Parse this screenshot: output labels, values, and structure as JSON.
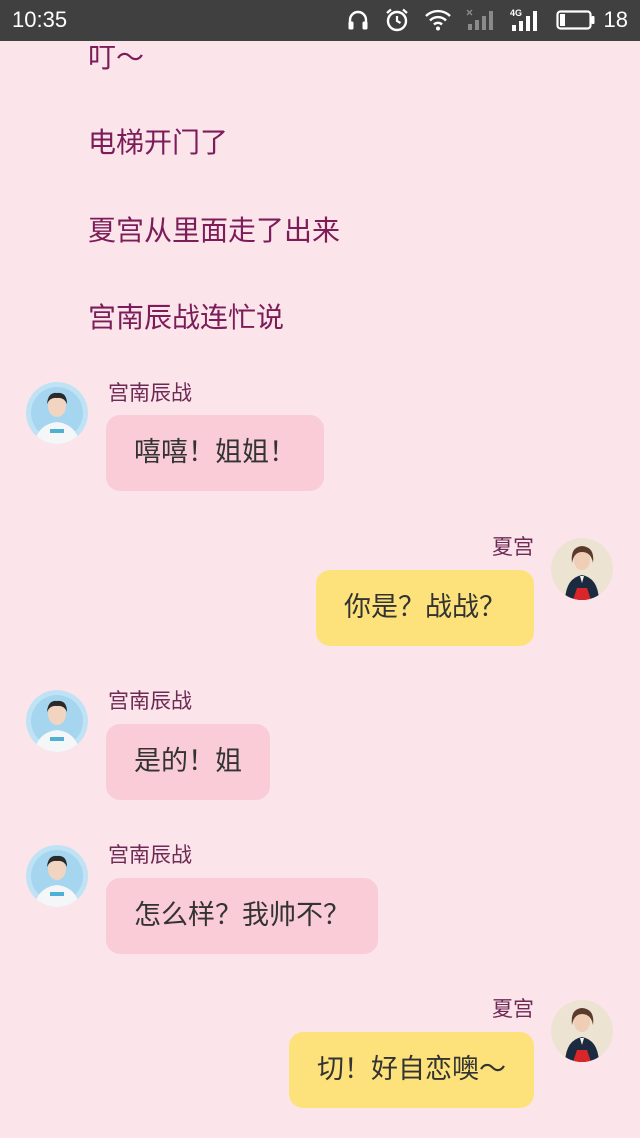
{
  "status_bar": {
    "time": "10:35",
    "battery": "18",
    "network": "4G",
    "icons": [
      "headphones-icon",
      "alarm-icon",
      "wifi-icon",
      "signal-weak-icon",
      "signal-4g-icon",
      "battery-icon"
    ]
  },
  "narration": [
    "叮～",
    "电梯开门了",
    "夏宫从里面走了出来",
    "宫南辰战连忙说"
  ],
  "messages": [
    {
      "sender": "宫南辰战",
      "side": "left",
      "text": "嘻嘻！姐姐！"
    },
    {
      "sender": "夏宫",
      "side": "right",
      "text": "你是？战战？"
    },
    {
      "sender": "宫南辰战",
      "side": "left",
      "text": "是的！姐"
    },
    {
      "sender": "宫南辰战",
      "side": "left",
      "text": "怎么样？我帅不？"
    },
    {
      "sender": "夏宫",
      "side": "right",
      "text": "切！好自恋噢～"
    }
  ],
  "colors": {
    "background": "#fbe4ea",
    "narration_text": "#7c1d59",
    "left_bubble": "#f9ccd8",
    "right_bubble": "#fde27b",
    "status_bar": "#404040"
  }
}
